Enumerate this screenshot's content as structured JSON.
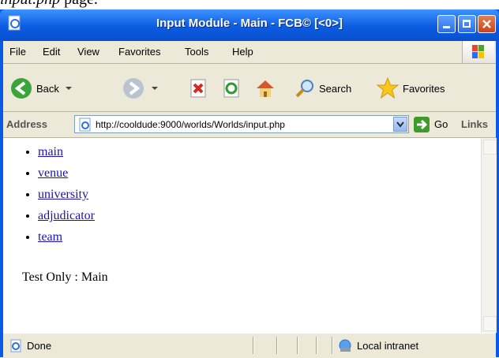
{
  "caption": {
    "code": "input.php",
    "rest": " page."
  },
  "window": {
    "title": "Input Module - Main - FCB© [<0>]"
  },
  "menu": [
    "File",
    "Edit",
    "View",
    "Favorites",
    "Tools",
    "Help"
  ],
  "toolbar": {
    "back_label": "Back",
    "search_label": "Search",
    "favorites_label": "Favorites"
  },
  "address": {
    "label": "Address",
    "url": "http://cooldude:9000/worlds/Worlds/input.php",
    "go_label": "Go",
    "links_label": "Links"
  },
  "content": {
    "links": [
      "main",
      "venue",
      "university",
      "adjudicator",
      "team"
    ],
    "note": "Test Only : Main"
  },
  "status": {
    "text": "Done",
    "zone": "Local intranet"
  }
}
